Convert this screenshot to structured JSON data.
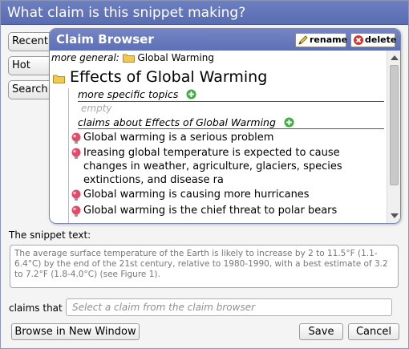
{
  "window": {
    "title": "What claim is this snippet making?"
  },
  "side_tabs": [
    {
      "label": "Recent"
    },
    {
      "label": "Hot"
    },
    {
      "label": "Search"
    }
  ],
  "claim_browser": {
    "title": "Claim Browser",
    "rename_label": "rename",
    "delete_label": "delete",
    "more_general_label": "more general:",
    "parent_topic": "Global Warming",
    "current_topic": "Effects of Global Warming",
    "more_specific_label": "more specific topics",
    "empty_label": "empty",
    "claims_about_label": "claims about Effects of Global Warming",
    "claims": [
      {
        "text": "Global warming is a serious problem"
      },
      {
        "text": "Ireasing global temperature is expected to cause changes in weather, agriculture, glaciers, species extinctions, and disease ra"
      },
      {
        "text": "Global warming is causing more hurricanes"
      },
      {
        "text": "Global warming is the chief threat to polar bears"
      }
    ]
  },
  "snippet": {
    "label": "The snippet text:",
    "text": "The average surface temperature of the Earth is likely to increase by 2 to 11.5°F (1.1-6.4°C) by the end of the 21st century, relative to 1980-1990, with a best estimate of 3.2 to 7.2°F (1.8-4.0°C) (see Figure 1)."
  },
  "claims_that": {
    "label": "claims that",
    "placeholder": "Select a claim from the claim browser"
  },
  "buttons": {
    "browse": "Browse in New Window",
    "save": "Save",
    "cancel": "Cancel"
  },
  "colors": {
    "title_bar": "#5f71b6",
    "bulb": "#e24b6a",
    "plus": "#3fae3f",
    "folder": "#f2c94c"
  }
}
